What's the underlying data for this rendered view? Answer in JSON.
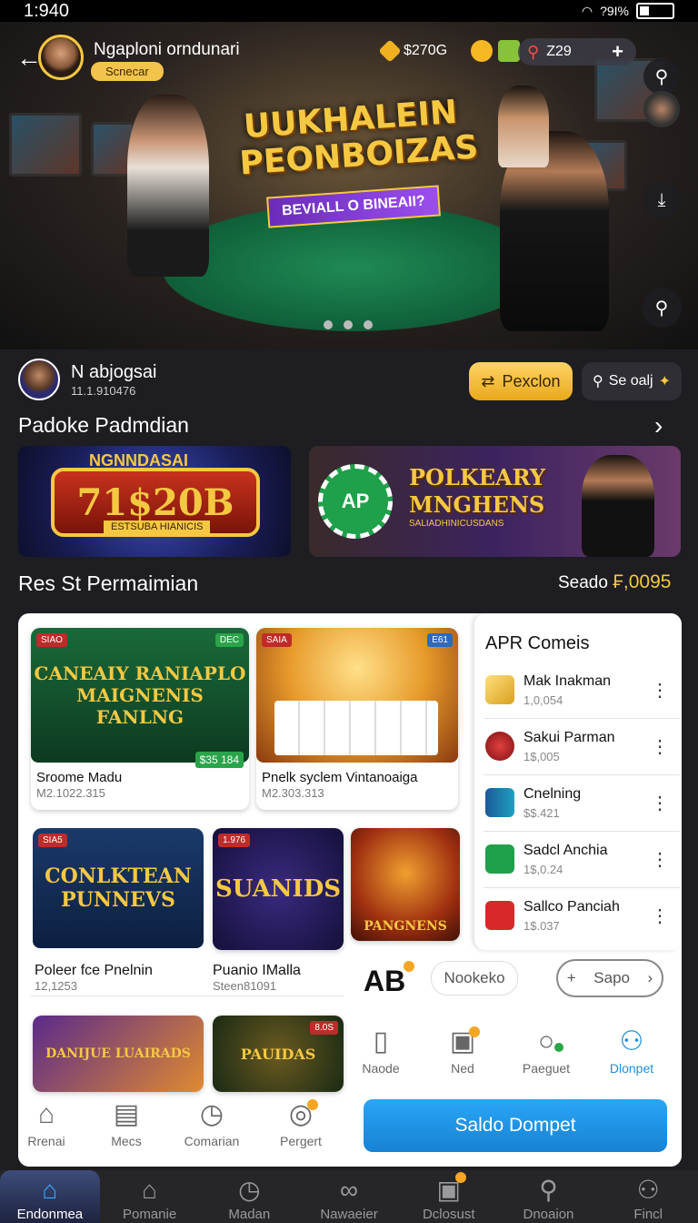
{
  "status": {
    "time": "1:940",
    "signal": "?9I%"
  },
  "header": {
    "user_name": "Ngaploni orndunari",
    "badge": "Scnecar",
    "coins": "$270G",
    "rank": "Z29"
  },
  "hero": {
    "title": "UUKHALEIN PEONBOIZAS",
    "subtitle": "BEVIALL O BINEAII?"
  },
  "user": {
    "name": "N abjogsai",
    "id": "11.1.910476",
    "primary_button": "Pexclon",
    "search_button": "Se oalj"
  },
  "promo_section": {
    "title": "Padoke Padmdian",
    "promo1": {
      "top": "NGNNDASAI",
      "reel": "71$20B",
      "bottom": "ESTSUBA HIANICIS"
    },
    "promo2": {
      "chip": "AP",
      "title_line1": "POLKEARY",
      "title_line2": "MNGHENS",
      "subtitle": "SALIADHINICUSDANS"
    }
  },
  "games_section": {
    "title": "Res St Permaimian",
    "saldo_label": "Seado",
    "saldo_value": "₣,0095"
  },
  "game_cards": [
    {
      "art": "CANEAIY RANIAPLO MAIGNENIS FANLNG",
      "tag": "SIAO",
      "tag2": "DEC",
      "price": "$35 184",
      "name": "Sroome Madu",
      "sub": "M2.1022.315"
    },
    {
      "art": "",
      "tag": "SAIA",
      "tag2": "E61",
      "name": "Pnelk syclem Vintanoaiga",
      "sub": "M2.303.313"
    },
    {
      "art": "CONLKTEAN PUNNEVS",
      "tag": "SIA5",
      "name": "Poleer fce Pnelnin",
      "sub": "12,1253"
    },
    {
      "art": "SUANIDS",
      "tag": "1.976",
      "name": "Puanio IMalla",
      "sub": "Steen81091"
    },
    {
      "art": "PANGNENS",
      "tag": "",
      "name": "",
      "sub": ""
    },
    {
      "art": "DANIJUE LUAIRADS",
      "tag": "",
      "name": "",
      "sub": ""
    },
    {
      "art": "PAUIDAS",
      "tag": "8.0S",
      "name": "",
      "sub": ""
    }
  ],
  "apr": {
    "title": "APR Comeis",
    "items": [
      {
        "name": "Mak Inakman",
        "value": "1,0,054"
      },
      {
        "name": "Sakui Parman",
        "value": "1$,005"
      },
      {
        "name": "Cnelning",
        "value": "$$.421"
      },
      {
        "name": "Sadcl Anchia",
        "value": "1$,0.24"
      },
      {
        "name": "Sallco Panciah",
        "value": "1$.037"
      }
    ]
  },
  "ab_row": {
    "logo": "AB",
    "chip": "Nookeko",
    "button": "Sapo"
  },
  "panel_tabs_left": [
    "Rrenai",
    "Mecs",
    "Comarian",
    "Pergert"
  ],
  "panel_tabs_right": [
    "Naode",
    "Ned",
    "Paeguet",
    "Dlonpet"
  ],
  "cta": "Saldo Dompet",
  "bottom_nav": [
    "Endonmea",
    "Pomanie",
    "Madan",
    "Nawaeier",
    "Dclosust",
    "Dnoaion",
    "Fincl"
  ],
  "colors": {
    "accent_gold": "#f5c842",
    "accent_blue": "#1f8fdb",
    "bg": "#1d1d22"
  }
}
